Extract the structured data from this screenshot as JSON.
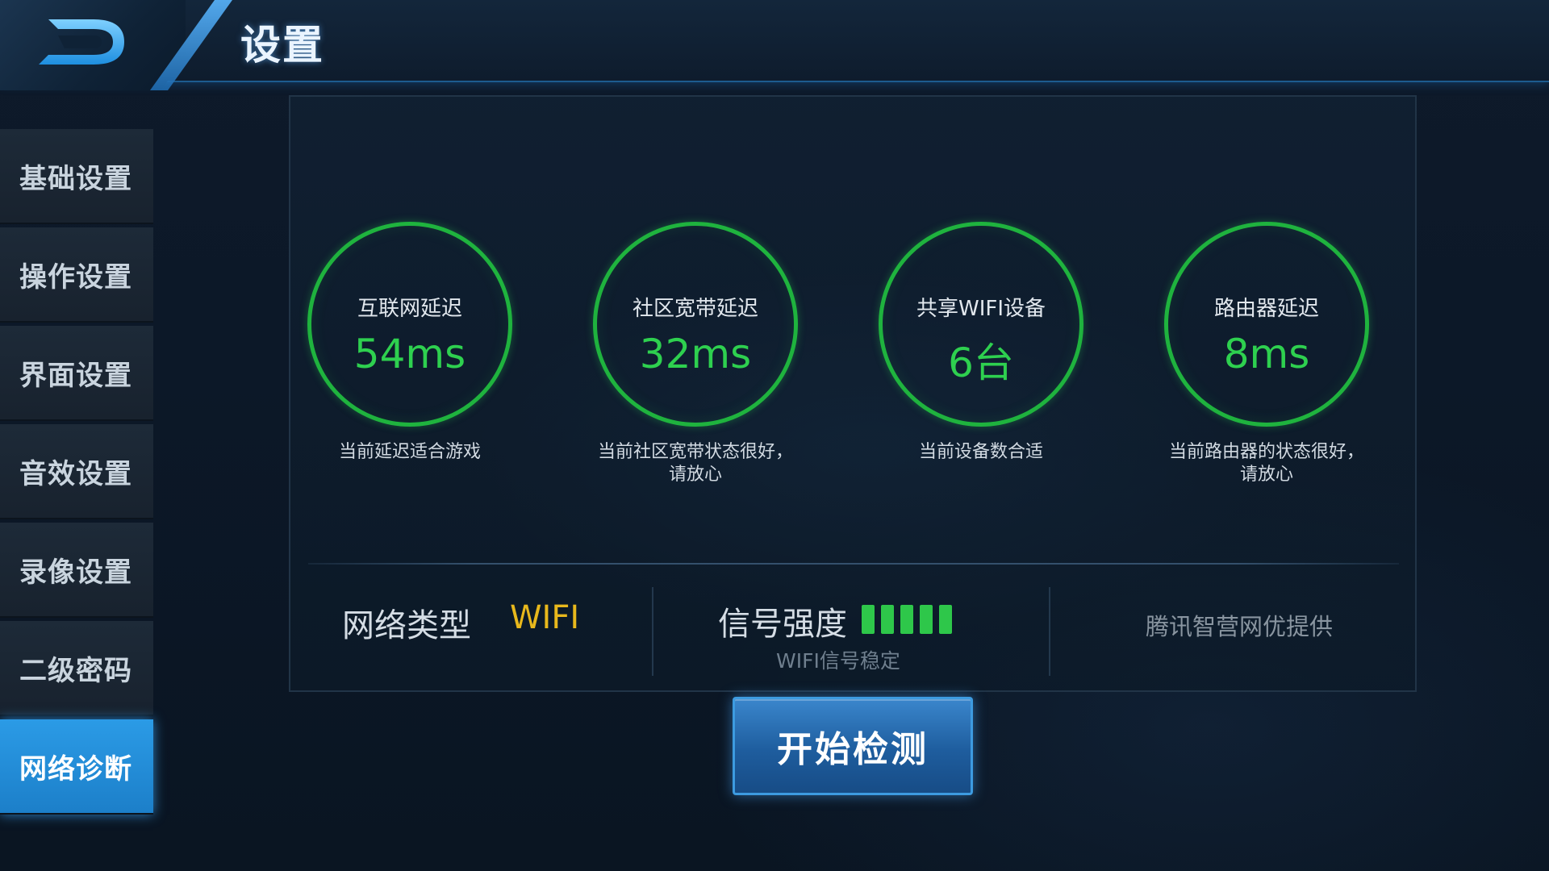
{
  "header": {
    "title": "设置",
    "back_icon": "back-arrow-icon"
  },
  "sidebar": {
    "items": [
      {
        "label": "基础设置",
        "active": false
      },
      {
        "label": "操作设置",
        "active": false
      },
      {
        "label": "界面设置",
        "active": false
      },
      {
        "label": "音效设置",
        "active": false
      },
      {
        "label": "录像设置",
        "active": false
      },
      {
        "label": "二级密码",
        "active": false
      },
      {
        "label": "网络诊断",
        "active": true
      }
    ]
  },
  "metrics": [
    {
      "label": "互联网延迟",
      "value": "54ms",
      "desc_lines": [
        "当前延迟适合游戏"
      ]
    },
    {
      "label": "社区宽带延迟",
      "value": "32ms",
      "desc_lines": [
        "当前社区宽带状态很好，",
        "请放心"
      ]
    },
    {
      "label": "共享WIFI设备",
      "value": "6台",
      "desc_lines": [
        "当前设备数合适"
      ]
    },
    {
      "label": "路由器延迟",
      "value": "8ms",
      "desc_lines": [
        "当前路由器的状态很好，",
        "请放心"
      ]
    }
  ],
  "network": {
    "type_label": "网络类型",
    "type_value": "WIFI",
    "signal_label": "信号强度",
    "signal_bars_filled": 5,
    "signal_bars_total": 5,
    "signal_desc": "WIFI信号稳定",
    "provider": "腾讯智营网优提供"
  },
  "actions": {
    "start_label": "开始检测"
  },
  "colors": {
    "accent_green": "#2ed04f",
    "accent_yellow": "#e8b81c",
    "active_tab_blue": "#2b9be6"
  }
}
